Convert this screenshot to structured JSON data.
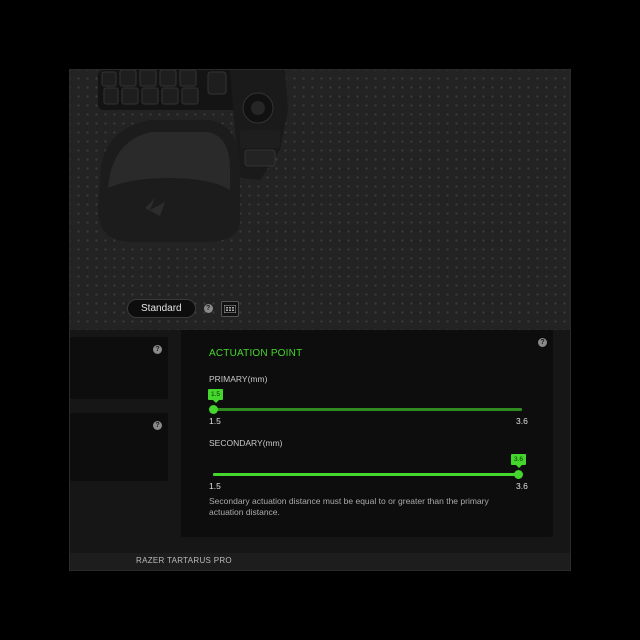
{
  "toolbar": {
    "profile_label": "Standard"
  },
  "actuation": {
    "title": "ACTUATION POINT",
    "primary": {
      "label": "PRIMARY(mm)",
      "value": "1.5",
      "min_label": "1.5",
      "max_label": "3.6",
      "fraction": 0.0
    },
    "secondary": {
      "label": "SECONDARY(mm)",
      "value": "3.6",
      "min_label": "1.5",
      "max_label": "3.6",
      "fraction": 1.0
    },
    "note": "Secondary actuation distance must be equal to or greater than the primary actuation distance."
  },
  "footer": {
    "device_name": "RAZER TARTARUS PRO"
  },
  "icons": {
    "help": "question-icon",
    "keypad": "keypad-layout-icon"
  },
  "colors": {
    "accent": "#44d62c",
    "background": "#161616",
    "card": "#0d0d0d"
  }
}
